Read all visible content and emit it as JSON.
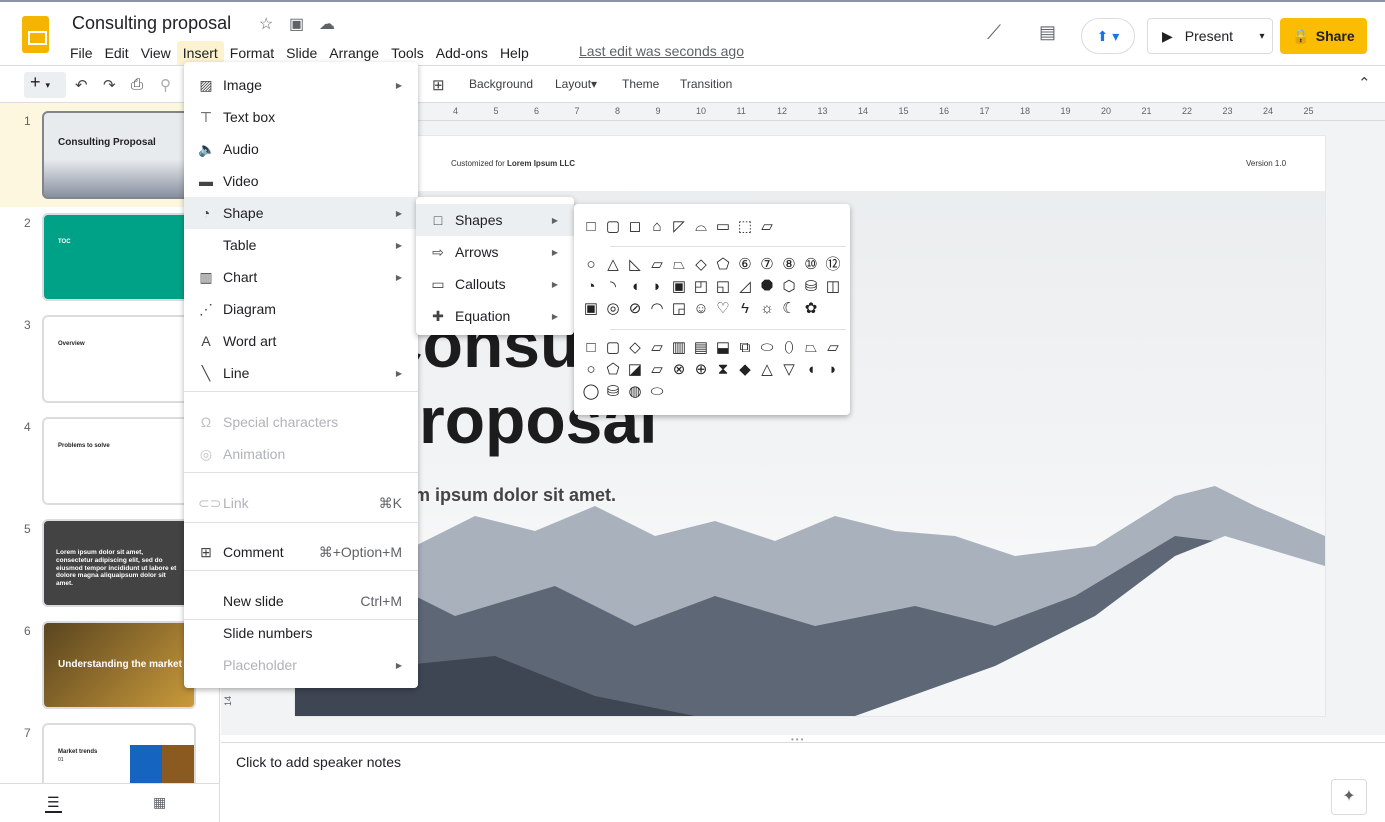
{
  "app": {
    "title": "Consulting proposal",
    "last_edit": "Last edit was seconds ago",
    "brand_color": "#f4b400"
  },
  "menubar": [
    "File",
    "Edit",
    "View",
    "Insert",
    "Format",
    "Slide",
    "Arrange",
    "Tools",
    "Add-ons",
    "Help"
  ],
  "header_buttons": {
    "present": "Present",
    "share": "Share",
    "share_color": "#fbbc04"
  },
  "toolbar": {
    "background": "Background",
    "layout": "Layout",
    "theme": "Theme",
    "transition": "Transition"
  },
  "ruler": [
    "4",
    "5",
    "6",
    "7",
    "8",
    "9",
    "10",
    "11",
    "12",
    "13",
    "14",
    "15",
    "16",
    "17",
    "18",
    "19",
    "20",
    "21",
    "22",
    "23",
    "24",
    "25"
  ],
  "vertical_ruler_label": "14",
  "slides": [
    {
      "num": "1",
      "title": "Consulting Proposal"
    },
    {
      "num": "2",
      "title": "TOC"
    },
    {
      "num": "3",
      "title": "Overview"
    },
    {
      "num": "4",
      "title": "Problems to solve"
    },
    {
      "num": "5",
      "title": "Lorem ipsum dolor sit amet, consectetur adipiscing elit, sed do eiusmod tempor incididunt ut labore et dolore magna aliquaipsum dolor sit amet."
    },
    {
      "num": "6",
      "title": "Understanding the market"
    },
    {
      "num": "7",
      "title": "Market trends",
      "sub": "01"
    }
  ],
  "slide": {
    "customized_prefix": "Customized for ",
    "client": "Lorem Ipsum LLC",
    "version": "Version 1.0",
    "title_line1": "Consulting",
    "title_line2": "Proposal",
    "subtitle": "Lorem ipsum dolor sit amet."
  },
  "notes_placeholder": "Click to add speaker notes",
  "insert_menu": [
    {
      "label": "Image",
      "icon": "image-icon",
      "submenu": true
    },
    {
      "label": "Text box",
      "icon": "text-box-icon"
    },
    {
      "label": "Audio",
      "icon": "audio-icon"
    },
    {
      "label": "Video",
      "icon": "video-icon"
    },
    {
      "label": "Shape",
      "icon": "shape-icon",
      "submenu": true
    },
    {
      "label": "Table",
      "submenu": true
    },
    {
      "label": "Chart",
      "icon": "chart-icon",
      "submenu": true
    },
    {
      "label": "Diagram",
      "icon": "diagram-icon"
    },
    {
      "label": "Word art",
      "icon": "word-art-icon"
    },
    {
      "label": "Line",
      "icon": "line-icon",
      "submenu": true
    },
    {
      "label": "Special characters",
      "icon": "omega-icon",
      "disabled": true
    },
    {
      "label": "Animation",
      "icon": "animation-icon",
      "disabled": true
    },
    {
      "label": "Link",
      "icon": "link-icon",
      "shortcut": "⌘K",
      "disabled": true
    },
    {
      "label": "Comment",
      "icon": "comment-icon",
      "shortcut": "⌘+Option+M"
    },
    {
      "label": "New slide",
      "shortcut": "Ctrl+M"
    },
    {
      "label": "Slide numbers"
    },
    {
      "label": "Placeholder",
      "submenu": true,
      "disabled": true
    }
  ],
  "shape_submenu": [
    {
      "label": "Shapes",
      "icon": "square-icon"
    },
    {
      "label": "Arrows",
      "icon": "arrow-icon"
    },
    {
      "label": "Callouts",
      "icon": "callout-icon"
    },
    {
      "label": "Equation",
      "icon": "plus-icon"
    }
  ],
  "shapes_panel": {
    "rectangles": [
      "□",
      "▢",
      "◻",
      "⌂",
      "◸",
      "⌓",
      "▭",
      "⬚",
      "▱"
    ],
    "basic1": [
      "○",
      "△",
      "◺",
      "▱",
      "⏢",
      "◇",
      "⬠",
      "⑥",
      "⑦",
      "⑧",
      "⑩",
      "⑫"
    ],
    "basic2": [
      "◔",
      "◝",
      "◖",
      "◗",
      "▣",
      "◰",
      "◱",
      "◿",
      "⯃",
      "⬡",
      "⛁",
      "◫"
    ],
    "basic3": [
      "▣",
      "◎",
      "⊘",
      "◠",
      "◲",
      "☺",
      "♡",
      "ϟ",
      "☼",
      "☾",
      "✿"
    ],
    "flow1": [
      "□",
      "▢",
      "◇",
      "▱",
      "▥",
      "▤",
      "⬓",
      "⧉",
      "⬭",
      "⬯",
      "⏢",
      "⏥"
    ],
    "flow2": [
      "○",
      "⬠",
      "◪",
      "⏥",
      "⊗",
      "⊕",
      "⧗",
      "◆",
      "△",
      "▽",
      "◖",
      "◗"
    ],
    "flow3": [
      "◯",
      "⛁",
      "◍",
      "⬭"
    ]
  }
}
